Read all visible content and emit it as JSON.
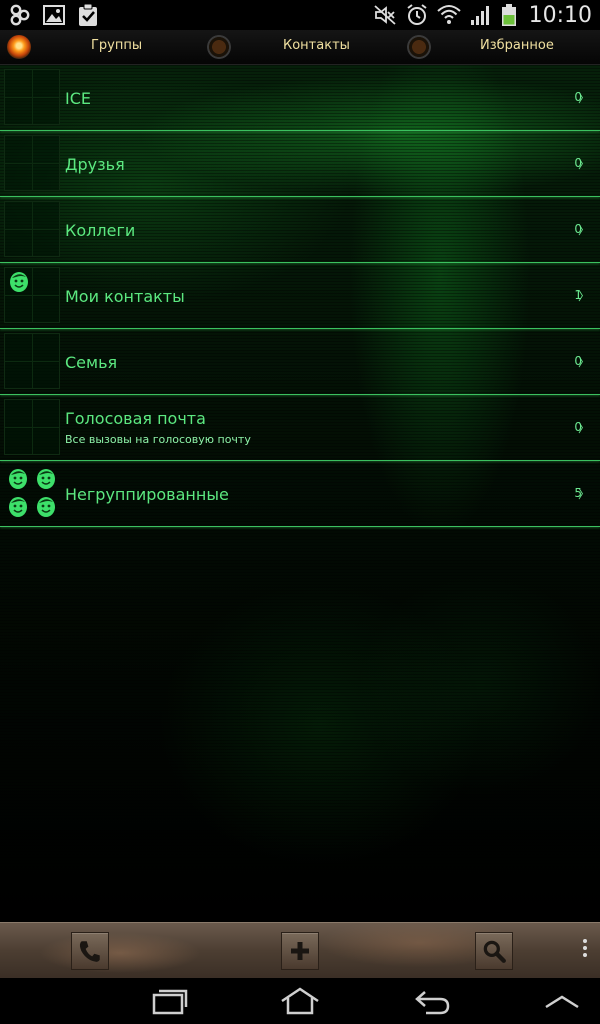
{
  "status_bar": {
    "left_icons": [
      "pinwheel-icon",
      "image-icon",
      "clipboard-check-icon"
    ],
    "right_icons": [
      "mute-icon",
      "alarm-icon",
      "wifi-icon",
      "signal-icon",
      "battery-icon"
    ],
    "time": "10:10"
  },
  "tabs": [
    {
      "label": "Группы",
      "active": true
    },
    {
      "label": "Контакты",
      "active": false
    },
    {
      "label": "Избранное",
      "active": false
    }
  ],
  "groups": [
    {
      "name": "ICE",
      "subtitle": "",
      "count": "0",
      "icon": "empty-thumbnail"
    },
    {
      "name": "Друзья",
      "subtitle": "",
      "count": "0",
      "icon": "empty-thumbnail"
    },
    {
      "name": "Коллеги",
      "subtitle": "",
      "count": "0",
      "icon": "empty-thumbnail"
    },
    {
      "name": "Мои контакты",
      "subtitle": "",
      "count": "1",
      "icon": "vault-boy-icon"
    },
    {
      "name": "Семья",
      "subtitle": "",
      "count": "0",
      "icon": "empty-thumbnail"
    },
    {
      "name": "Голосовая почта",
      "subtitle": "Все вызовы на голосовую почту",
      "count": "0",
      "icon": "empty-thumbnail"
    },
    {
      "name": "Негруппированные",
      "subtitle": "",
      "count": "5",
      "icon": "vault-boy-group-icon"
    }
  ],
  "chevron": "〉",
  "toolbar": {
    "buttons": [
      "phone-icon",
      "plus-icon",
      "search-icon",
      "overflow-menu-icon"
    ]
  },
  "navbar": {
    "buttons": [
      "recent-apps-icon",
      "home-icon",
      "back-icon",
      "hide-keyboard-icon"
    ]
  },
  "colors": {
    "accent_green": "#5ce880",
    "tab_label": "#f0e0a0",
    "active_lamp": "#ff9a1a",
    "toolbar_brown": "#5a4a3c"
  }
}
